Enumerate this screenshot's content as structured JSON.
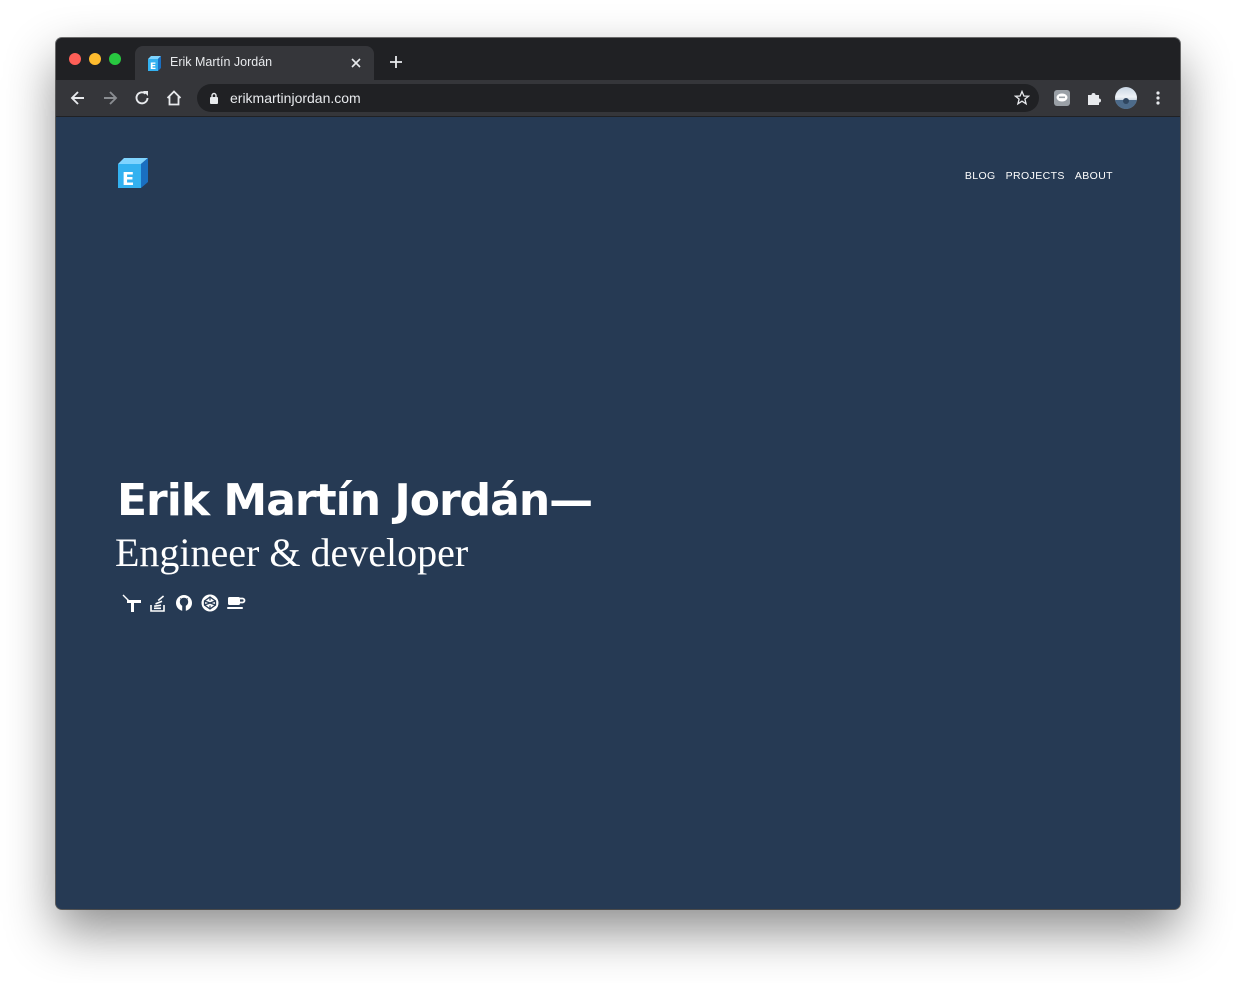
{
  "browser": {
    "tab": {
      "title": "Erik Martín Jordán",
      "favicon": "erik-logo-icon",
      "close_icon": "close-icon"
    },
    "new_tab_icon": "plus-icon",
    "toolbar": {
      "back_icon": "arrow-left-icon",
      "forward_icon": "arrow-right-icon",
      "reload_icon": "reload-icon",
      "home_icon": "home-icon",
      "url": "erikmartinjordan.com",
      "lock_icon": "lock-icon",
      "bookmark_icon": "star-icon",
      "extension1_icon": "chat-extension-icon",
      "extensions_icon": "puzzle-icon",
      "profile": "avatar",
      "menu_icon": "kebab-menu-icon"
    }
  },
  "site": {
    "logo": "erik-logo-icon",
    "nav": [
      {
        "label": "BLOG"
      },
      {
        "label": "PROJECTS"
      },
      {
        "label": "ABOUT"
      }
    ],
    "hero": {
      "name": "Erik Martín Jordán—",
      "role": "Engineer & developer"
    },
    "social_icons": [
      "twitter-like-icon",
      "stackoverflow-icon",
      "github-icon",
      "codepen-icon",
      "coffee-icon"
    ]
  },
  "colors": {
    "page_background": "#263a54",
    "tabstrip": "#202124",
    "toolbar": "#35363a",
    "text": "#ffffff",
    "logo_light": "#33b1f0",
    "logo_dark": "#1a6fc1"
  }
}
